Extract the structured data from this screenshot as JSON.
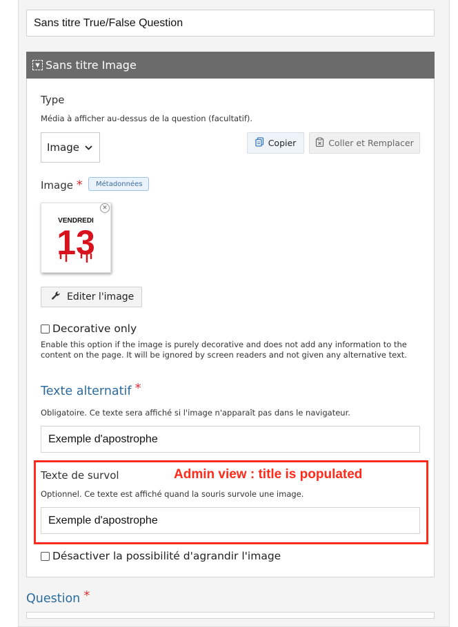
{
  "form": {
    "title_value": "Sans titre True/False Question",
    "image_group": {
      "header": "Sans titre Image",
      "type": {
        "label": "Type",
        "description": "Média à afficher au-dessus de la question (facultatif).",
        "selected": "Image",
        "copy_button": "Copier",
        "paste_button": "Coller et Remplacer"
      },
      "image": {
        "label": "Image",
        "required_mark": "*",
        "metadata_badge": "Métadonnées",
        "thumbnail": {
          "top_text": "VENDREDI",
          "number": "13"
        },
        "edit_button": "Editer l'image"
      },
      "decorative": {
        "label": "Decorative only",
        "description": "Enable this option if the image is purely decorative and does not add any information to the content on the page. It will be ignored by screen readers and not given any alternative text."
      },
      "alt_text": {
        "label": "Texte alternatif",
        "required_mark": "*",
        "description": "Obligatoire. Ce texte sera affiché si l'image n'apparaît pas dans le navigateur.",
        "value": "Exemple d'apostrophe"
      },
      "hover_text": {
        "label": "Texte de survol",
        "description": "Optionnel. Ce texte est affiché quand la souris survole une image.",
        "value": "Exemple d'apostrophe"
      },
      "disable_zoom": {
        "label": "Désactiver la possibilité d'agrandir l'image"
      }
    },
    "question": {
      "label": "Question",
      "required_mark": "*"
    }
  },
  "annotation": {
    "text": "Admin view : title is populated",
    "color": "#ff2a1a"
  },
  "icons": {
    "collapse": "collapse-icon",
    "chevron": "chevron-down-icon",
    "copy": "copy-icon",
    "paste": "paste-icon",
    "wrench": "wrench-icon",
    "close": "close-icon"
  },
  "colors": {
    "header_bg": "#6b6b6b",
    "link_blue": "#2c6b9e",
    "required_red": "#d93030"
  }
}
